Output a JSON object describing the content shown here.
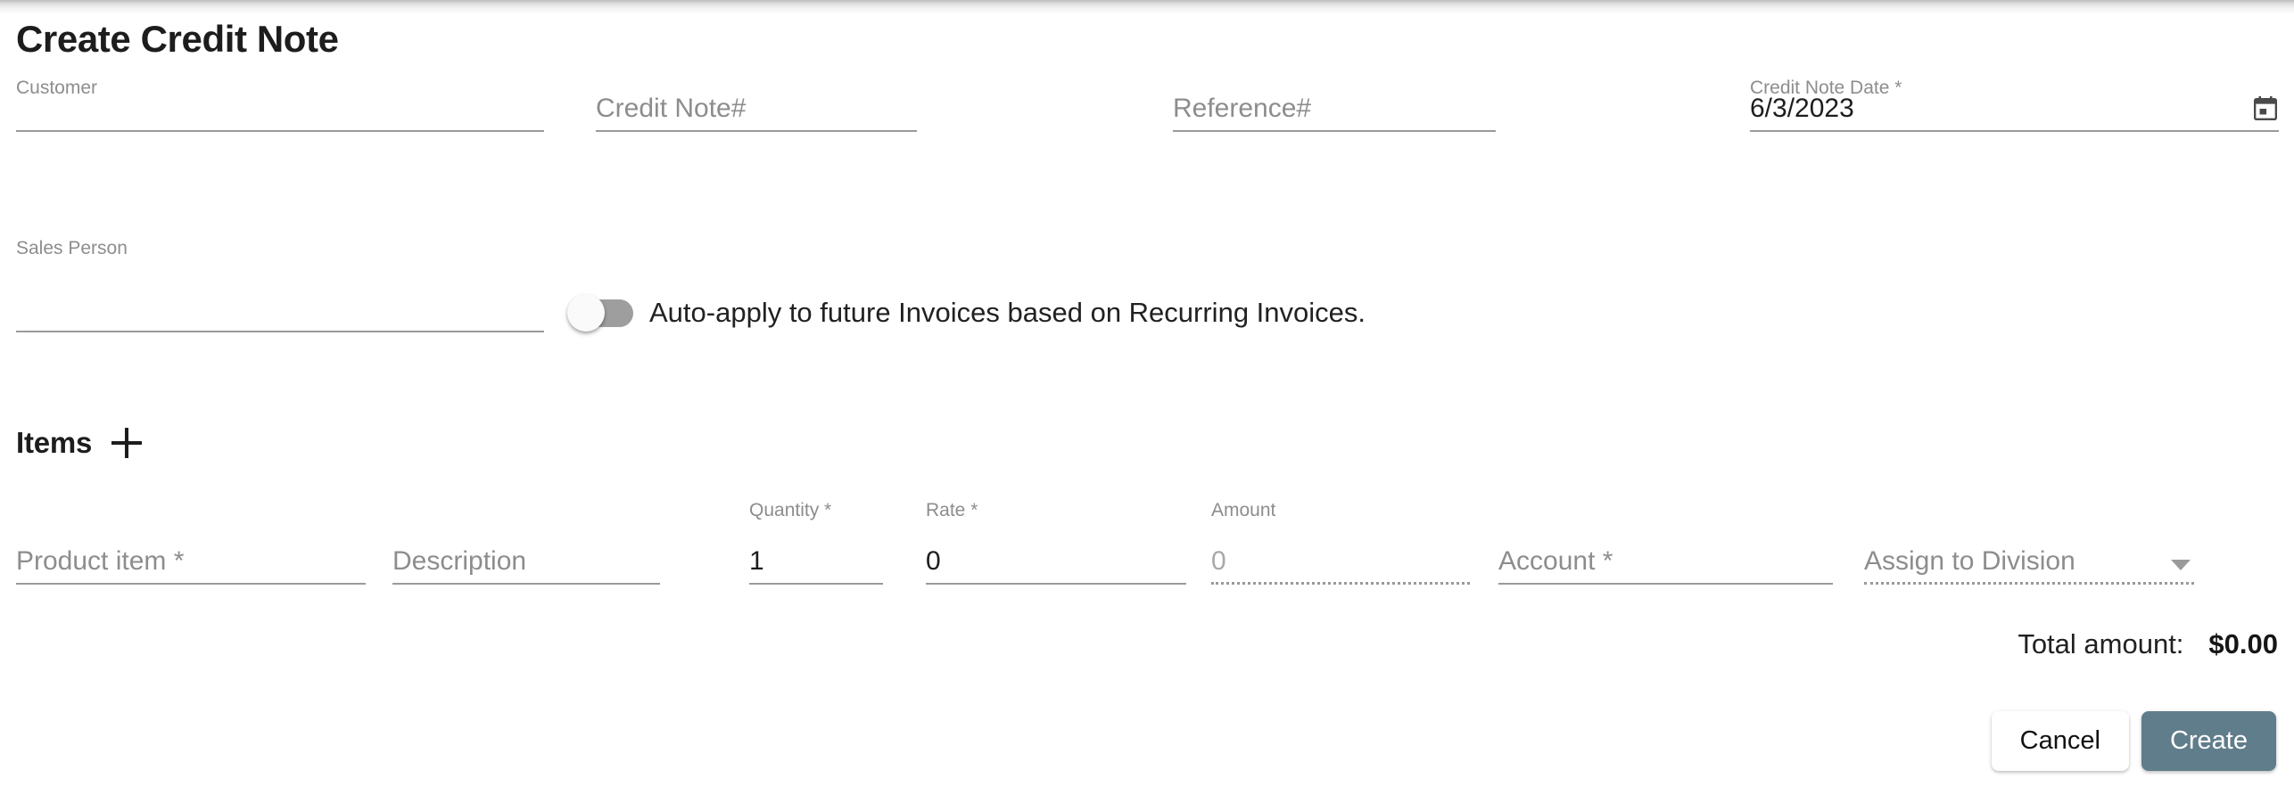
{
  "dialog": {
    "title": "Create Credit Note"
  },
  "form": {
    "customer": {
      "label": "Customer",
      "value": "",
      "placeholder": ""
    },
    "credit_note_number": {
      "label": "",
      "value": "",
      "placeholder": "Credit Note#"
    },
    "reference_number": {
      "label": "",
      "value": "",
      "placeholder": "Reference#"
    },
    "credit_note_date": {
      "label": "Credit Note Date *",
      "value": "6/3/2023",
      "icon": "calendar-icon"
    },
    "sales_person": {
      "label": "Sales Person",
      "value": "",
      "placeholder": ""
    },
    "auto_apply": {
      "label": "Auto-apply to future Invoices based on Recurring Invoices.",
      "state": "off"
    }
  },
  "items": {
    "title": "Items",
    "add_icon": "plus-icon",
    "columns": [
      {
        "label": "",
        "placeholder": "Product item *",
        "value": "",
        "style": "solid"
      },
      {
        "label": "",
        "placeholder": "Description",
        "value": "",
        "style": "solid"
      },
      {
        "label": "Quantity *",
        "placeholder": "",
        "value": "1",
        "style": "solid"
      },
      {
        "label": "Rate *",
        "placeholder": "",
        "value": "0",
        "style": "solid"
      },
      {
        "label": "Amount",
        "placeholder": "",
        "value": "0",
        "style": "dotted"
      },
      {
        "label": "",
        "placeholder": "Account *",
        "value": "",
        "style": "solid"
      },
      {
        "label": "",
        "placeholder": "Assign to Division",
        "value": "",
        "style": "dotted",
        "icon": "chevron-down-icon"
      }
    ]
  },
  "totals": {
    "label": "Total amount:",
    "value": "$0.00"
  },
  "actions": {
    "cancel_label": "Cancel",
    "create_label": "Create"
  },
  "colors": {
    "primary_button": "#607d8b",
    "underline": "#9a9a9a",
    "label_text": "#8d8d8d",
    "body_text": "#212121"
  }
}
